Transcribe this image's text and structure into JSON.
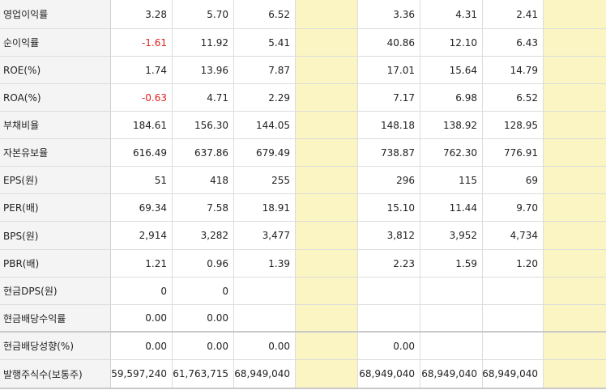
{
  "rows": [
    {
      "label": "영업이익률",
      "v": [
        "3.28",
        "5.70",
        "6.52",
        "",
        "3.36",
        "4.31",
        "2.41",
        ""
      ],
      "neg": [
        false,
        false,
        false,
        false,
        false,
        false,
        false,
        false
      ]
    },
    {
      "label": "순이익률",
      "v": [
        "-1.61",
        "11.92",
        "5.41",
        "",
        "40.86",
        "12.10",
        "6.43",
        ""
      ],
      "neg": [
        true,
        false,
        false,
        false,
        false,
        false,
        false,
        false
      ]
    },
    {
      "label": "ROE(%)",
      "v": [
        "1.74",
        "13.96",
        "7.87",
        "",
        "17.01",
        "15.64",
        "14.79",
        ""
      ],
      "neg": [
        false,
        false,
        false,
        false,
        false,
        false,
        false,
        false
      ]
    },
    {
      "label": "ROA(%)",
      "v": [
        "-0.63",
        "4.71",
        "2.29",
        "",
        "7.17",
        "6.98",
        "6.52",
        ""
      ],
      "neg": [
        true,
        false,
        false,
        false,
        false,
        false,
        false,
        false
      ]
    },
    {
      "label": "부채비율",
      "v": [
        "184.61",
        "156.30",
        "144.05",
        "",
        "148.18",
        "138.92",
        "128.95",
        ""
      ],
      "neg": [
        false,
        false,
        false,
        false,
        false,
        false,
        false,
        false
      ]
    },
    {
      "label": "자본유보율",
      "v": [
        "616.49",
        "637.86",
        "679.49",
        "",
        "738.87",
        "762.30",
        "776.91",
        ""
      ],
      "neg": [
        false,
        false,
        false,
        false,
        false,
        false,
        false,
        false
      ]
    },
    {
      "label": "EPS(원)",
      "v": [
        "51",
        "418",
        "255",
        "",
        "296",
        "115",
        "69",
        ""
      ],
      "neg": [
        false,
        false,
        false,
        false,
        false,
        false,
        false,
        false
      ]
    },
    {
      "label": "PER(배)",
      "v": [
        "69.34",
        "7.58",
        "18.91",
        "",
        "15.10",
        "11.44",
        "9.70",
        ""
      ],
      "neg": [
        false,
        false,
        false,
        false,
        false,
        false,
        false,
        false
      ]
    },
    {
      "label": "BPS(원)",
      "v": [
        "2,914",
        "3,282",
        "3,477",
        "",
        "3,812",
        "3,952",
        "4,734",
        ""
      ],
      "neg": [
        false,
        false,
        false,
        false,
        false,
        false,
        false,
        false
      ]
    },
    {
      "label": "PBR(배)",
      "v": [
        "1.21",
        "0.96",
        "1.39",
        "",
        "2.23",
        "1.59",
        "1.20",
        ""
      ],
      "neg": [
        false,
        false,
        false,
        false,
        false,
        false,
        false,
        false
      ]
    },
    {
      "label": "현금DPS(원)",
      "v": [
        "0",
        "0",
        "",
        "",
        "",
        "",
        "",
        ""
      ],
      "neg": [
        false,
        false,
        false,
        false,
        false,
        false,
        false,
        false
      ]
    },
    {
      "label": "현금배당수익률",
      "v": [
        "0.00",
        "0.00",
        "",
        "",
        "",
        "",
        "",
        ""
      ],
      "neg": [
        false,
        false,
        false,
        false,
        false,
        false,
        false,
        false
      ]
    },
    {
      "label": "현금배당성향(%)",
      "v": [
        "0.00",
        "0.00",
        "0.00",
        "",
        "0.00",
        "",
        "",
        ""
      ],
      "neg": [
        false,
        false,
        false,
        false,
        false,
        false,
        false,
        false
      ]
    },
    {
      "label": "발행주식수(보통주)",
      "v": [
        "59,597,240",
        "61,763,715",
        "68,949,040",
        "",
        "68,949,040",
        "68,949,040",
        "68,949,040",
        ""
      ],
      "neg": [
        false,
        false,
        false,
        false,
        false,
        false,
        false,
        false
      ]
    }
  ],
  "colors": {
    "highlight": "#fbf5c3",
    "negative": "#e02020",
    "label_bg": "#f4f4f4"
  }
}
